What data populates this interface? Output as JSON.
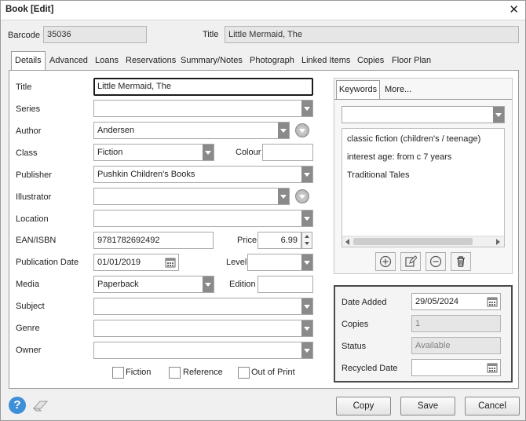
{
  "window": {
    "title": "Book [Edit]",
    "close_glyph": "✕"
  },
  "header": {
    "barcode_label": "Barcode",
    "barcode_value": "35036",
    "title_label": "Title",
    "title_value": "Little Mermaid, The"
  },
  "tabs": [
    "Details",
    "Advanced",
    "Loans",
    "Reservations",
    "Summary/Notes",
    "Photograph",
    "Linked Items",
    "Copies",
    "Floor Plan"
  ],
  "active_tab": "Details",
  "form": {
    "title": {
      "label": "Title",
      "value": "Little Mermaid, The"
    },
    "series": {
      "label": "Series",
      "value": ""
    },
    "author": {
      "label": "Author",
      "value": "Andersen"
    },
    "class": {
      "label": "Class",
      "value": "Fiction"
    },
    "colour": {
      "label": "Colour",
      "value": ""
    },
    "publisher": {
      "label": "Publisher",
      "value": "Pushkin Children's Books"
    },
    "illustrator": {
      "label": "Illustrator",
      "value": ""
    },
    "location": {
      "label": "Location",
      "value": ""
    },
    "isbn": {
      "label": "EAN/ISBN",
      "value": "9781782692492"
    },
    "price": {
      "label": "Price",
      "value": "6.99"
    },
    "pubdate": {
      "label": "Publication Date",
      "value": "01/01/2019"
    },
    "level": {
      "label": "Level",
      "value": ""
    },
    "media": {
      "label": "Media",
      "value": "Paperback"
    },
    "edition": {
      "label": "Edition",
      "value": ""
    },
    "subject": {
      "label": "Subject",
      "value": ""
    },
    "genre": {
      "label": "Genre",
      "value": ""
    },
    "owner": {
      "label": "Owner",
      "value": ""
    }
  },
  "checkboxes": {
    "fiction": "Fiction",
    "reference": "Reference",
    "outofprint": "Out of Print"
  },
  "keywords": {
    "tabs": [
      "Keywords",
      "More..."
    ],
    "items": [
      "classic fiction (children's / teenage)",
      "interest age: from c 7 years",
      "Traditional Tales"
    ]
  },
  "info": {
    "date_added_label": "Date Added",
    "date_added_value": "29/05/2024",
    "copies_label": "Copies",
    "copies_value": "1",
    "status_label": "Status",
    "status_value": "Available",
    "recycled_label": "Recycled Date",
    "recycled_value": ""
  },
  "buttons": {
    "copy": "Copy",
    "save": "Save",
    "cancel": "Cancel"
  },
  "colors": {
    "accent": "#1a1a1a",
    "arrow": "#8a8a8a",
    "help_blue": "#3d8fd8"
  }
}
